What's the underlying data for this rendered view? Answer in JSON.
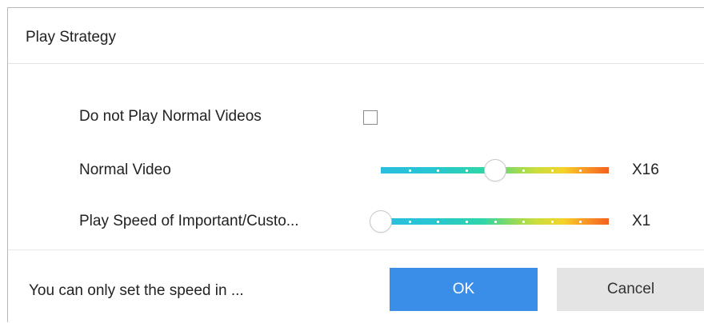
{
  "dialog": {
    "title": "Play Strategy",
    "rows": [
      {
        "label": "Do not Play Normal Videos",
        "checked": false
      },
      {
        "label": "Normal Video",
        "speed": "X16",
        "slider_fraction": 0.5
      },
      {
        "label": "Play Speed of Important/Custo...",
        "speed": "X1",
        "slider_fraction": 0.0
      }
    ],
    "footer": {
      "hint": "You can only set the speed in ...",
      "ok_label": "OK",
      "cancel_label": "Cancel"
    }
  },
  "colors": {
    "ok_button": "#3b8ee8",
    "cancel_button": "#e4e4e4",
    "slider_gradient": [
      "#2bbde0",
      "#2fd5a8",
      "#c9de3e",
      "#f5d32a",
      "#f5611f"
    ]
  }
}
